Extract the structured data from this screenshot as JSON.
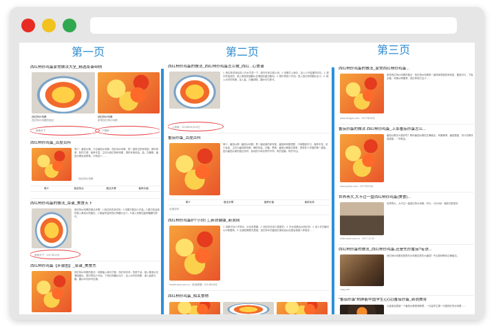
{
  "labels": {
    "page1": "第一页",
    "page2": "第二页",
    "page3": "第三页"
  },
  "col1": {
    "r1_title": "西红柿炒鸡蛋家常做法大全_精选菜谱48例",
    "r1_cap_left": "西红柿炒鸡蛋",
    "r1_cap_left2": "西红柿炒鸡蛋的做法",
    "r1_cap_right": "西红柿炒鸡蛋",
    "r1_cap_right2": "家常西红柿炒鸡蛋",
    "r1_src_left": "美食天下",
    "r1_src_right": "下厨房",
    "r2_title": "西红柿炒鸡蛋_百度百科",
    "r2_snip": "简介：番茄炒蛋，又名番茄炒鸡蛋、西红柿炒鸡蛋，是一道常见的家常菜。原料简单，制作方便，营养丰富。主料为西红柿和鸡蛋，调料有食用油、盐、白糖等。番茄炒蛋色泽鲜艳，口味宜人……",
    "r2_link": "西红柿炒鸡蛋",
    "r2_tabs": [
      "简介",
      "食品特点",
      "做法步骤",
      "营养价值"
    ],
    "r3_title": "西红柿炒鸡蛋的做法_菜谱_美食天下",
    "r3_snip": "西红柿炒鸡蛋的做法步骤：1.西红柿洗净切块；2.鸡蛋打散加少许盐；3.锅中放油烧热倒入蛋液炒熟盛出；4.锅留底油放西红柿翻炒出汁；5.倒入鸡蛋加盐和糖翻匀即可。",
    "r3_src": "美食天下 · 2017年12月",
    "r4_title": "西红柿炒鸡蛋【步骤图】_菜谱_美食杰",
    "r4_snip": "西红柿炒鸡蛋的做法：鸡蛋磕入碗中打散，西红柿切块。热锅下油，倒入蛋液炒至凝固盛出。锅中再加少许油，下西红柿翻炒出汁，加入炒好的鸡蛋，调入盐和白糖，翻炒均匀即可出锅。"
  },
  "col2": {
    "r1_title": "西红柿炒鸡蛋的做法_西红柿炒鸡蛋怎么做_西红...心食谱",
    "r1_snip": "1. 西红柿洗净后放入开水中烫一下，剥去外皮切成小块；2. 鸡蛋打入碗中，加入少许盐搅拌均匀；3. 锅中放油烧热，倒入蛋液快速翻炒至凝固后盛出备用；4. 锅中再放少许油，放入西红柿块翻炒出汁；5. 倒入炒好的鸡蛋，加入盐、白糖调味，翻炒均匀即可。",
    "r1_src": "心食谱 · 2015年04月15日",
    "r2_title": "番茄炒蛋_百度百科",
    "r2_snip": "简介：番茄炒蛋（番茄炒鸡蛋）是一道经典的家常菜，番茄和鸡蛋搭配，口味酸甜可口，营养丰富，老少皆宜。主料为番茄和鸡蛋，辅料有盐、白糖、葱等。番茄炒蛋做法简单，是很多人学做的第一道菜。因为番茄炒蛋的做法多样，各地的口味也有所不同，有的加糖，有的不加。",
    "r2_tabs": [
      "简介",
      "做法步骤",
      "营养价值",
      "食用功效"
    ],
    "r2_footer": "百度百科",
    "r3_title": "西红柿炒鸡蛋8个小窍门_新浪健康_新浪网",
    "r3_snip": "1. 鸡蛋中加少许清水，炒出来更嫩；2. 西红柿去皮口感更好；3. 先炒鸡蛋后炒西红柿；4. 加少许白糖可以中和酸味；5. 出锅前撒葱花更香。西红柿中的番茄红素用油炒后更容易被人体吸收……",
    "r3_src": "health.sina.com.cn · 新浪健康 · 2014年08月",
    "r4_title": "西红柿炒鸡蛋_相关食物"
  },
  "col3": {
    "r1_title": "西红柿炒鸡蛋的做法_家常西红柿炒鸡蛋...",
    "r1_snip": "家常西红柿炒鸡蛋的做法：西红柿炒鸡蛋是一道简单易做的家常菜，酸甜可口，下饭必备。鸡蛋炒得嫩滑，西红柿软烂出汁……",
    "r1_src": "www.douguo.com · 2017年05月",
    "r2_title": "番茄炒蛋的做法 西红柿炒鸡蛋_上菜番茄炒蛋怎么...",
    "r2_snip": "番茄炒蛋怎么做好吃？教你番茄炒蛋的正确做法，鸡蛋嫩滑，番茄酸甜，汤汁浓郁拌饭超香，一学就会。",
    "r2_src": "www.youku.com · 2017年04月",
    "r3_title": "世界再大,大不过一盘西红柿炒鸡蛋(美食)...",
    "r3_snip": "世界再大，大不过一盘西红柿炒鸡蛋。时长：4分30秒 · 播放次数很多",
    "r3_src": "video.sina.com.cn · 2017-11-02",
    "r4_title": "西红柿炒蛋的做法_西红柿炒鸡蛋,还是先炒番茄?有诀...",
    "r4_snip": "西红柿炒鸡蛋到底是先炒鸡蛋还是先炒番茄？专业厨师教你正确做法。",
    "r4_src": "v.qq.com",
    "r5_title": "\"番茄炒蛋\"刷屏能中国学生心(完)番茄炒蛋_新浪教育",
    "r5_snip": "大量朋友圈被一个番茄炒蛋视频刷屏，一位留学生第一次做西红柿炒鸡蛋……"
  }
}
